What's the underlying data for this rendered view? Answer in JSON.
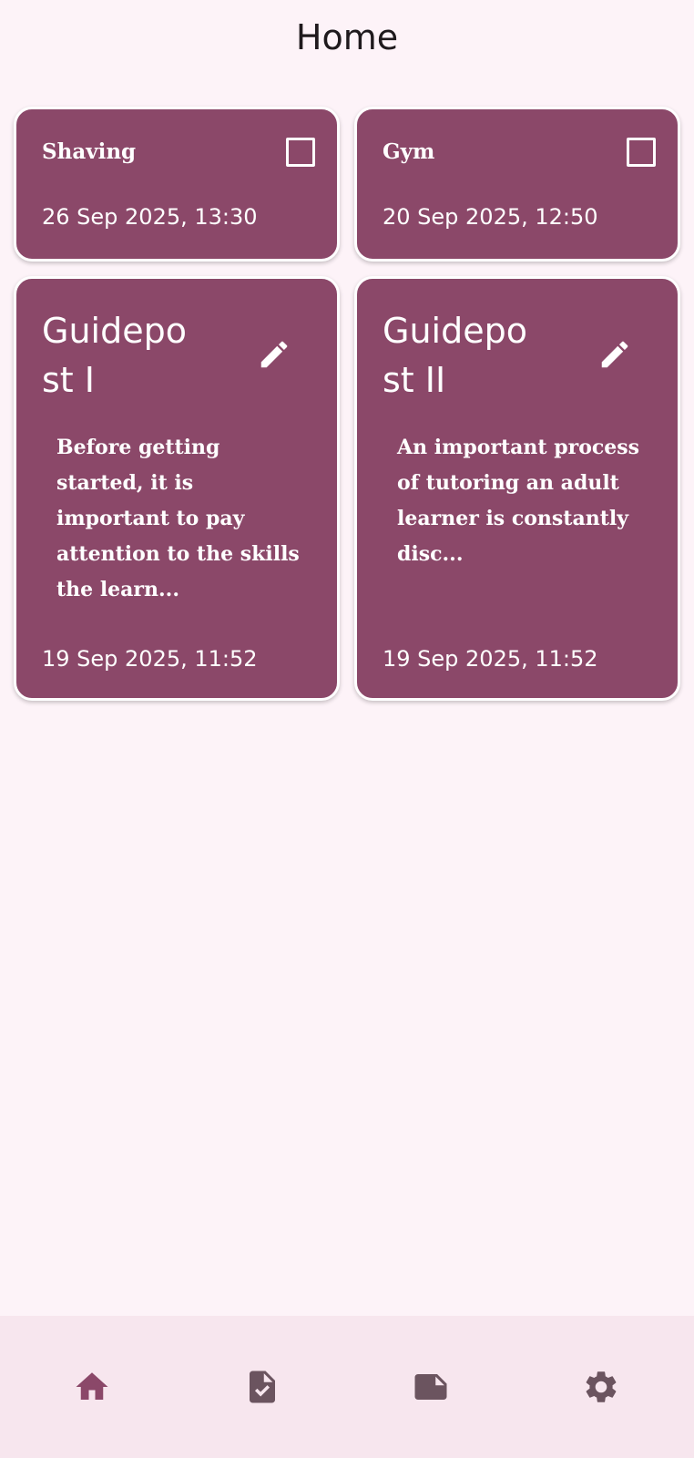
{
  "header": {
    "title": "Home"
  },
  "tasks": [
    {
      "title": "Shaving",
      "datetime": "26 Sep 2025, 13:30",
      "checked": false
    },
    {
      "title": "Gym",
      "datetime": "20 Sep 2025, 12:50",
      "checked": false
    }
  ],
  "notes": [
    {
      "title": "Guidepost I",
      "preview": "Before getting started, it is important to pay attention to the skills the learn...",
      "datetime": "19 Sep 2025, 11:52"
    },
    {
      "title": "Guidepost II",
      "preview": "An important process of tutoring an adult learner is constantly disc...",
      "datetime": "19 Sep 2025, 11:52"
    }
  ],
  "bottom_nav": {
    "items": [
      {
        "icon": "home-icon",
        "active": true
      },
      {
        "icon": "task-document-icon",
        "active": false
      },
      {
        "icon": "note-icon",
        "active": false
      },
      {
        "icon": "settings-icon",
        "active": false
      }
    ]
  },
  "colors": {
    "background": "#fdf3f8",
    "card": "#8b4869",
    "nav_background": "#f7e6ee",
    "nav_active": "#8b4869",
    "nav_inactive": "#6b545f"
  }
}
